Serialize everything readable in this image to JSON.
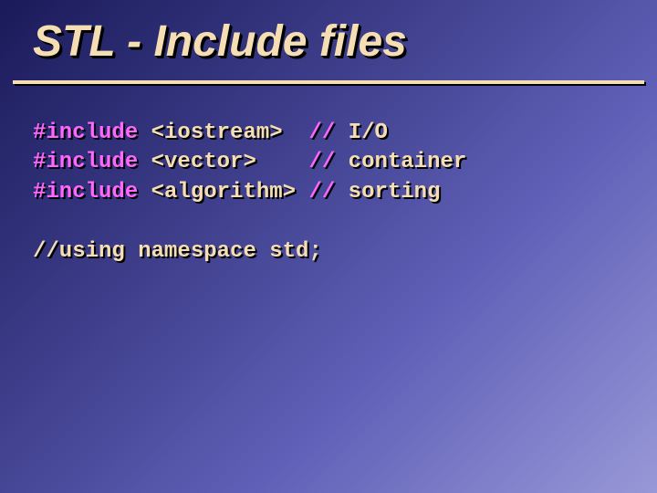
{
  "title": "STL - Include files",
  "code": {
    "lines": [
      {
        "include_kw": "#include",
        "header": "<iostream> ",
        "sep": " // ",
        "comment": "I/O"
      },
      {
        "include_kw": "#include",
        "header": "<vector>   ",
        "sep": " // ",
        "comment": "container"
      },
      {
        "include_kw": "#include",
        "header": "<algorithm>",
        "sep": " // ",
        "comment": "sorting"
      }
    ],
    "blank": "",
    "footer": "//using namespace std;"
  }
}
